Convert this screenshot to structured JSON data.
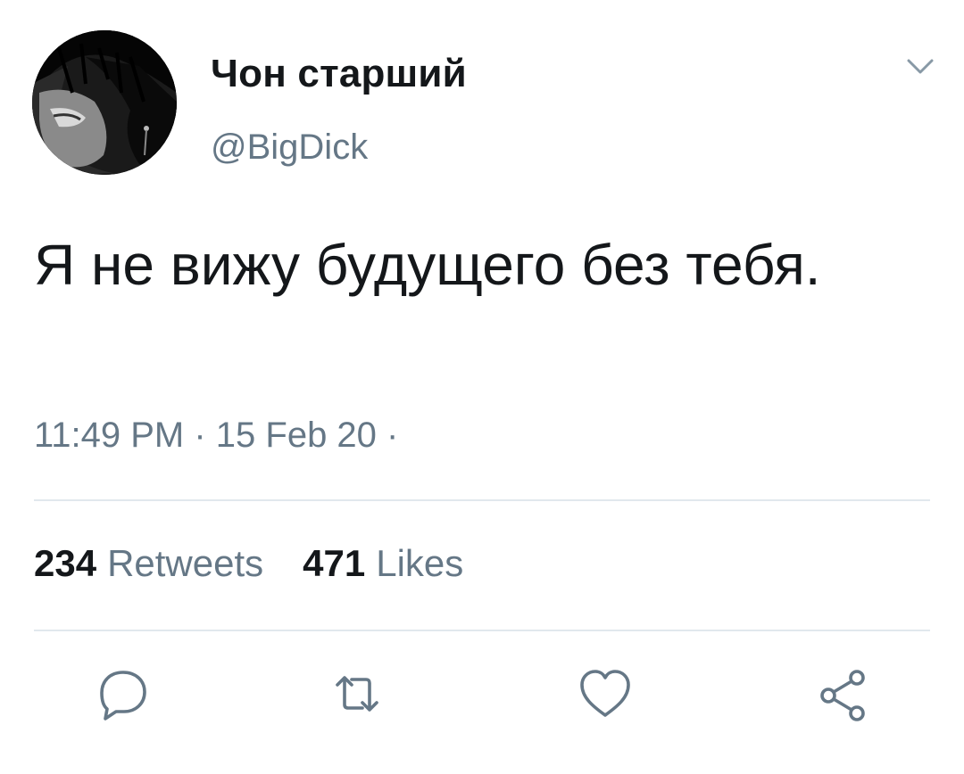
{
  "user": {
    "display_name": "Чон старший",
    "handle": "@BigDick"
  },
  "tweet": {
    "text": "Я не вижу будущего без тебя.",
    "timestamp": "11:49 PM · 15 Feb 20 ·"
  },
  "stats": {
    "retweets_count": "234",
    "retweets_label": "Retweets",
    "likes_count": "471",
    "likes_label": "Likes"
  },
  "icons": {
    "menu": "chevron-down-icon",
    "reply": "reply-icon",
    "retweet": "retweet-icon",
    "like": "heart-icon",
    "share": "share-icon"
  },
  "colors": {
    "text_primary": "#14171a",
    "text_secondary": "#657786",
    "divider": "#e1e8ed"
  }
}
